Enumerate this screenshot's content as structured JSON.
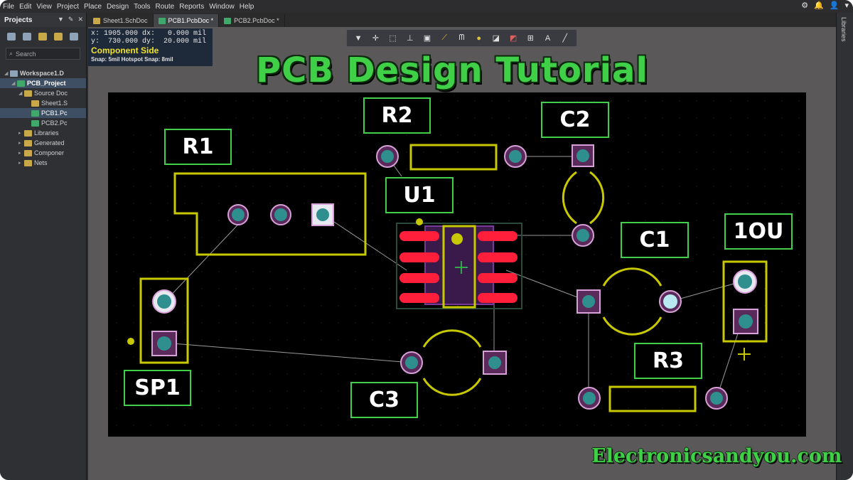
{
  "menu": [
    "File",
    "Edit",
    "View",
    "Project",
    "Place",
    "Design",
    "Tools",
    "Route",
    "Reports",
    "Window",
    "Help"
  ],
  "panel": {
    "title": "Projects",
    "search_placeholder": "Search",
    "tree": [
      {
        "label": "Workspace1.D",
        "level": 0,
        "icon": "workspace-icon",
        "selected": false
      },
      {
        "label": "PCB_Project",
        "level": 1,
        "icon": "project-icon",
        "selected": true
      },
      {
        "label": "Source Doc",
        "level": 2,
        "icon": "folder-icon",
        "selected": false
      },
      {
        "label": "Sheet1.S",
        "level": 3,
        "icon": "schematic-icon",
        "selected": false
      },
      {
        "label": "PCB1.Pc",
        "level": 3,
        "icon": "pcb-icon",
        "selected": true
      },
      {
        "label": "PCB2.Pc",
        "level": 3,
        "icon": "pcb-icon",
        "selected": false
      },
      {
        "label": "Libraries",
        "level": 2,
        "icon": "folder-icon",
        "selected": false
      },
      {
        "label": "Generated",
        "level": 2,
        "icon": "folder-icon",
        "selected": false
      },
      {
        "label": "Componer",
        "level": 2,
        "icon": "folder-icon",
        "selected": false
      },
      {
        "label": "Nets",
        "level": 2,
        "icon": "folder-icon",
        "selected": false
      }
    ]
  },
  "tabs": [
    {
      "label": "Sheet1.SchDoc",
      "active": false
    },
    {
      "label": "PCB1.PcbDoc *",
      "active": true
    },
    {
      "label": "PCB2.PcbDoc *",
      "active": false
    }
  ],
  "right_panel": {
    "label": "Libraries"
  },
  "coord_readout": {
    "line1": "x: 1905.000 dx:   0.000 mil",
    "line2": "y:  730.000 dy:  20.000 mil",
    "side": "Component Side",
    "snap": "Snap: 5mil Hotspot Snap: 8mil"
  },
  "title": "PCB Design Tutorial",
  "components": {
    "r1": "R1",
    "r2": "R2",
    "c2": "C2",
    "u1": "U1",
    "c1": "C1",
    "ou": "1OU",
    "sp1": "SP1",
    "r3": "R3",
    "c3": "C3"
  },
  "watermark": "Electronicsandyou.com",
  "colors": {
    "title_green": "#3fd048",
    "silkscreen": "#c8c800",
    "pad_teal": "#2f8f8f",
    "pad_ring": "#d8a0d8",
    "smd_red": "#ff1f3a"
  }
}
